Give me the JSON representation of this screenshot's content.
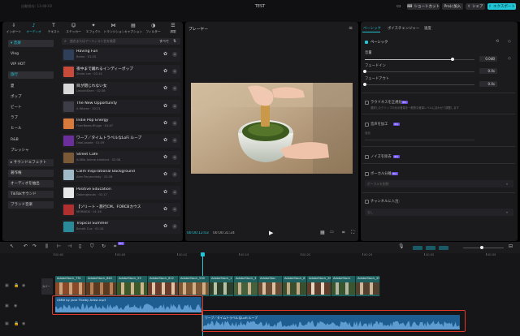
{
  "colors": {
    "accent": "#20c5d6",
    "audio": "#1d5d8f",
    "video": "#1f6a69",
    "highlight": "#e0392b",
    "badge": "#6b4fe0"
  },
  "topbar": {
    "title": "TEST",
    "autosave": "自動保存: 13:48:02",
    "shortcut": "ショートカット",
    "pro": "Proに加入",
    "share": "シェア",
    "export": "エクスポート"
  },
  "toolbar": [
    {
      "label": "インポート",
      "icon": "import-icon"
    },
    {
      "label": "オーディオ",
      "icon": "audio-icon"
    },
    {
      "label": "テキスト",
      "icon": "text-icon"
    },
    {
      "label": "ステッカー",
      "icon": "sticker-icon"
    },
    {
      "label": "エフェクト",
      "icon": "effect-icon"
    },
    {
      "label": "トランジション",
      "icon": "transition-icon"
    },
    {
      "label": "キャプション",
      "icon": "caption-icon"
    },
    {
      "label": "フィルター",
      "icon": "filter-icon"
    },
    {
      "label": "調整",
      "icon": "adjust-icon"
    }
  ],
  "categories": {
    "music_header": "▾ 音楽",
    "items": [
      "Vlog",
      "VIP HOT",
      "旅行",
      "夏",
      "ポップ",
      "ビート",
      "ラブ",
      "ヒール",
      "R&B",
      "プレッシャ"
    ],
    "sound_effects": "▸ サウンドエフェクト",
    "extra": [
      "著作権",
      "オーディオを抽出",
      "TikTokサウンド",
      "ブランド音楽"
    ]
  },
  "search": {
    "placeholder": "曲名またはアーティスト名を検索",
    "filter": "すべて"
  },
  "tracks": [
    {
      "title": "Having Fun",
      "sub": "Bemo · 01:20",
      "color": "#2f3f5a"
    },
    {
      "title": "夜中まで踊れるインディーポップ",
      "sub": "Shota Lee · 02:14",
      "color": "#c84a3a"
    },
    {
      "title": "目が閉じれない女",
      "sub": "LincolnShen · 02:38",
      "color": "#d8d8d8"
    },
    {
      "title": "The New Opportunity",
      "sub": "A Whean · 02:21",
      "color": "#3d3d48"
    },
    {
      "title": "Indie Pop Energy",
      "sub": "FiverBeats.Rhyge · 01:47",
      "color": "#d87a3c"
    },
    {
      "title": "ワープ／タイムトラベルなLoFi ループ",
      "sub": "OdaCosade · 01:39",
      "color": "#6a2f9a"
    },
    {
      "title": "Street Cafe",
      "sub": "AI-Bibi Anime Ambient · 02:08",
      "color": "#7a5a36"
    },
    {
      "title": "Calm Inspirational Background",
      "sub": "Alen Poryendisky · 02:28",
      "color": "#9fb9c7"
    },
    {
      "title": "Positive Education",
      "sub": "Dabenghouts · 01:17",
      "color": "#e8e8e8"
    },
    {
      "title": "【ソリート・旅行CM、FORCBカウス",
      "sub": "MORIBOX · 01:16",
      "color": "#b03030"
    },
    {
      "title": "Tropical Summer",
      "sub": "Benelt Cux · 02:18",
      "color": "#2a8a9a"
    }
  ],
  "player": {
    "label": "プレーヤー",
    "time_current": "00:00:12:03",
    "time_total": "00:00:31:24"
  },
  "props": {
    "tabs": [
      "ベーシック",
      "ボイスチェンジャー",
      "速度"
    ],
    "basic": "ベーシック",
    "volume_label": "音量",
    "volume_value": "0.0dB",
    "volume_level": 0.8,
    "fadein_label": "フェードイン",
    "fadein_value": "0.0s",
    "fadeout_label": "フェードアウト",
    "fadeout_value": "0.0s",
    "loudness_label": "ラウドネスを正規化",
    "loudness_desc": "選択したクリップの元の音量を一般的な音量レベルに合わせて調整します",
    "enhance_label": "音声を加工",
    "enhance_sub": "強化",
    "noise_label": "ノイズを除去",
    "vocal_label": "ボーカル分離",
    "vocal_select": "ボーカルを削除",
    "channel_label": "チャンネルに入力",
    "channel_select": "なし",
    "badge": "Pro"
  },
  "timeline": {
    "ticks": [
      "00:00",
      "00:05",
      "00:10",
      "00:15",
      "00:20",
      "00:25",
      "00:30",
      "00:35"
    ],
    "cover_label": "カバー",
    "audio1": "OMW by Jane Thelby Artist.mp3",
    "audio2": "ワープ／タイムトラベルなLoFi ループ",
    "clips": [
      "AdobeStock_731",
      "AdobeStock_840",
      "AdobeStock_53",
      "AdobeStock_612",
      "AdobeStock_530",
      "AdobeStock_1",
      "AdobeStock_3",
      "AdobeStoc",
      "AdobeStock_6",
      "AdobeStock_281",
      "AdobeStock",
      "AdobeStock_25"
    ]
  }
}
